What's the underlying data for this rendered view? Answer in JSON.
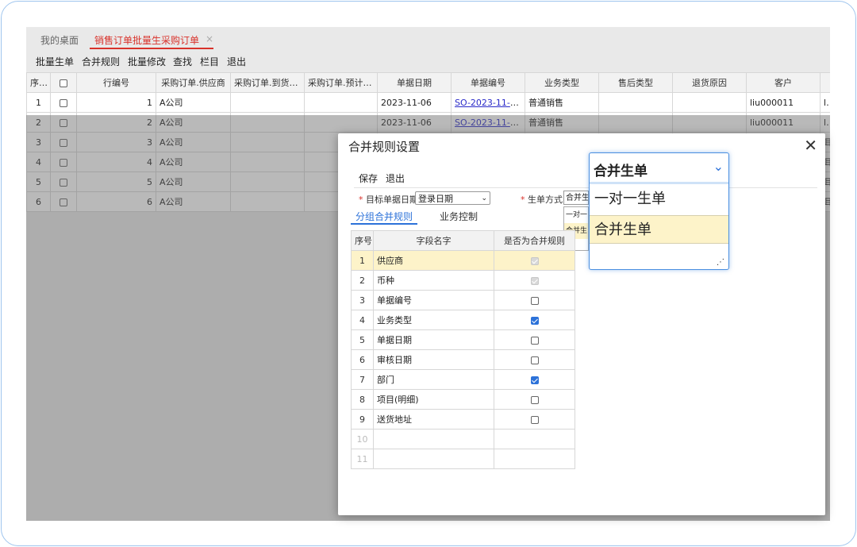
{
  "tabs": {
    "home": "我的桌面",
    "active": "销售订单批量生采购订单"
  },
  "toolbar": [
    "批量生单",
    "合并规则",
    "批量修改",
    "查找",
    "栏目",
    "退出"
  ],
  "grid": {
    "headers": [
      "序号",
      "",
      "行编号",
      "采购订单.供应商",
      "采购订单.到货地址",
      "采购订单.预计到...",
      "单据日期",
      "单据编号",
      "业务类型",
      "售后类型",
      "退货原因",
      "客户",
      ""
    ],
    "rows": [
      {
        "seq": "1",
        "line": "1",
        "vendor": "A公司",
        "date": "2023-11-06",
        "code": "SO-2023-11-0...",
        "biz": "普通销售",
        "customer": "liu000011",
        "extra": "liu"
      },
      {
        "seq": "2",
        "line": "2",
        "vendor": "A公司",
        "date": "2023-11-06",
        "code": "SO-2023-11-0...",
        "biz": "普通销售",
        "customer": "liu000011",
        "extra": "liu"
      },
      {
        "seq": "3",
        "line": "3",
        "vendor": "A公司",
        "date": "",
        "code": "",
        "biz": "",
        "customer": "",
        "extra": "耳"
      },
      {
        "seq": "4",
        "line": "4",
        "vendor": "A公司",
        "date": "",
        "code": "",
        "biz": "",
        "customer": "",
        "extra": "耳"
      },
      {
        "seq": "5",
        "line": "5",
        "vendor": "A公司",
        "date": "",
        "code": "",
        "biz": "",
        "customer": "",
        "extra": "耳"
      },
      {
        "seq": "6",
        "line": "6",
        "vendor": "A公司",
        "date": "",
        "code": "",
        "biz": "",
        "customer": "",
        "extra": "耳"
      }
    ]
  },
  "dialog": {
    "title": "合并规则设置",
    "save": "保存",
    "exit": "退出",
    "target_date_label": "目标单据日期",
    "target_date_value": "登录日期",
    "mode_label": "生单方式",
    "mode_value": "合并生",
    "mini_options": [
      "一对一",
      "合并生"
    ],
    "subtabs": [
      "分组合并规则",
      "业务控制"
    ],
    "rules_headers": [
      "序号",
      "字段名字",
      "是否为合并规则"
    ],
    "rules": [
      {
        "idx": "1",
        "name": "供应商",
        "state": "disabled"
      },
      {
        "idx": "2",
        "name": "币种",
        "state": "disabled"
      },
      {
        "idx": "3",
        "name": "单据编号",
        "state": "unchecked"
      },
      {
        "idx": "4",
        "name": "业务类型",
        "state": "checked"
      },
      {
        "idx": "5",
        "name": "单据日期",
        "state": "unchecked"
      },
      {
        "idx": "6",
        "name": "审核日期",
        "state": "unchecked"
      },
      {
        "idx": "7",
        "name": "部门",
        "state": "checked"
      },
      {
        "idx": "8",
        "name": "项目(明细)",
        "state": "unchecked"
      },
      {
        "idx": "9",
        "name": "送货地址",
        "state": "unchecked"
      },
      {
        "idx": "10",
        "name": "",
        "state": "none"
      },
      {
        "idx": "11",
        "name": "",
        "state": "none"
      }
    ]
  },
  "zoom": {
    "selected": "合并生单",
    "options": [
      "一对一生单",
      "合并生单"
    ]
  }
}
